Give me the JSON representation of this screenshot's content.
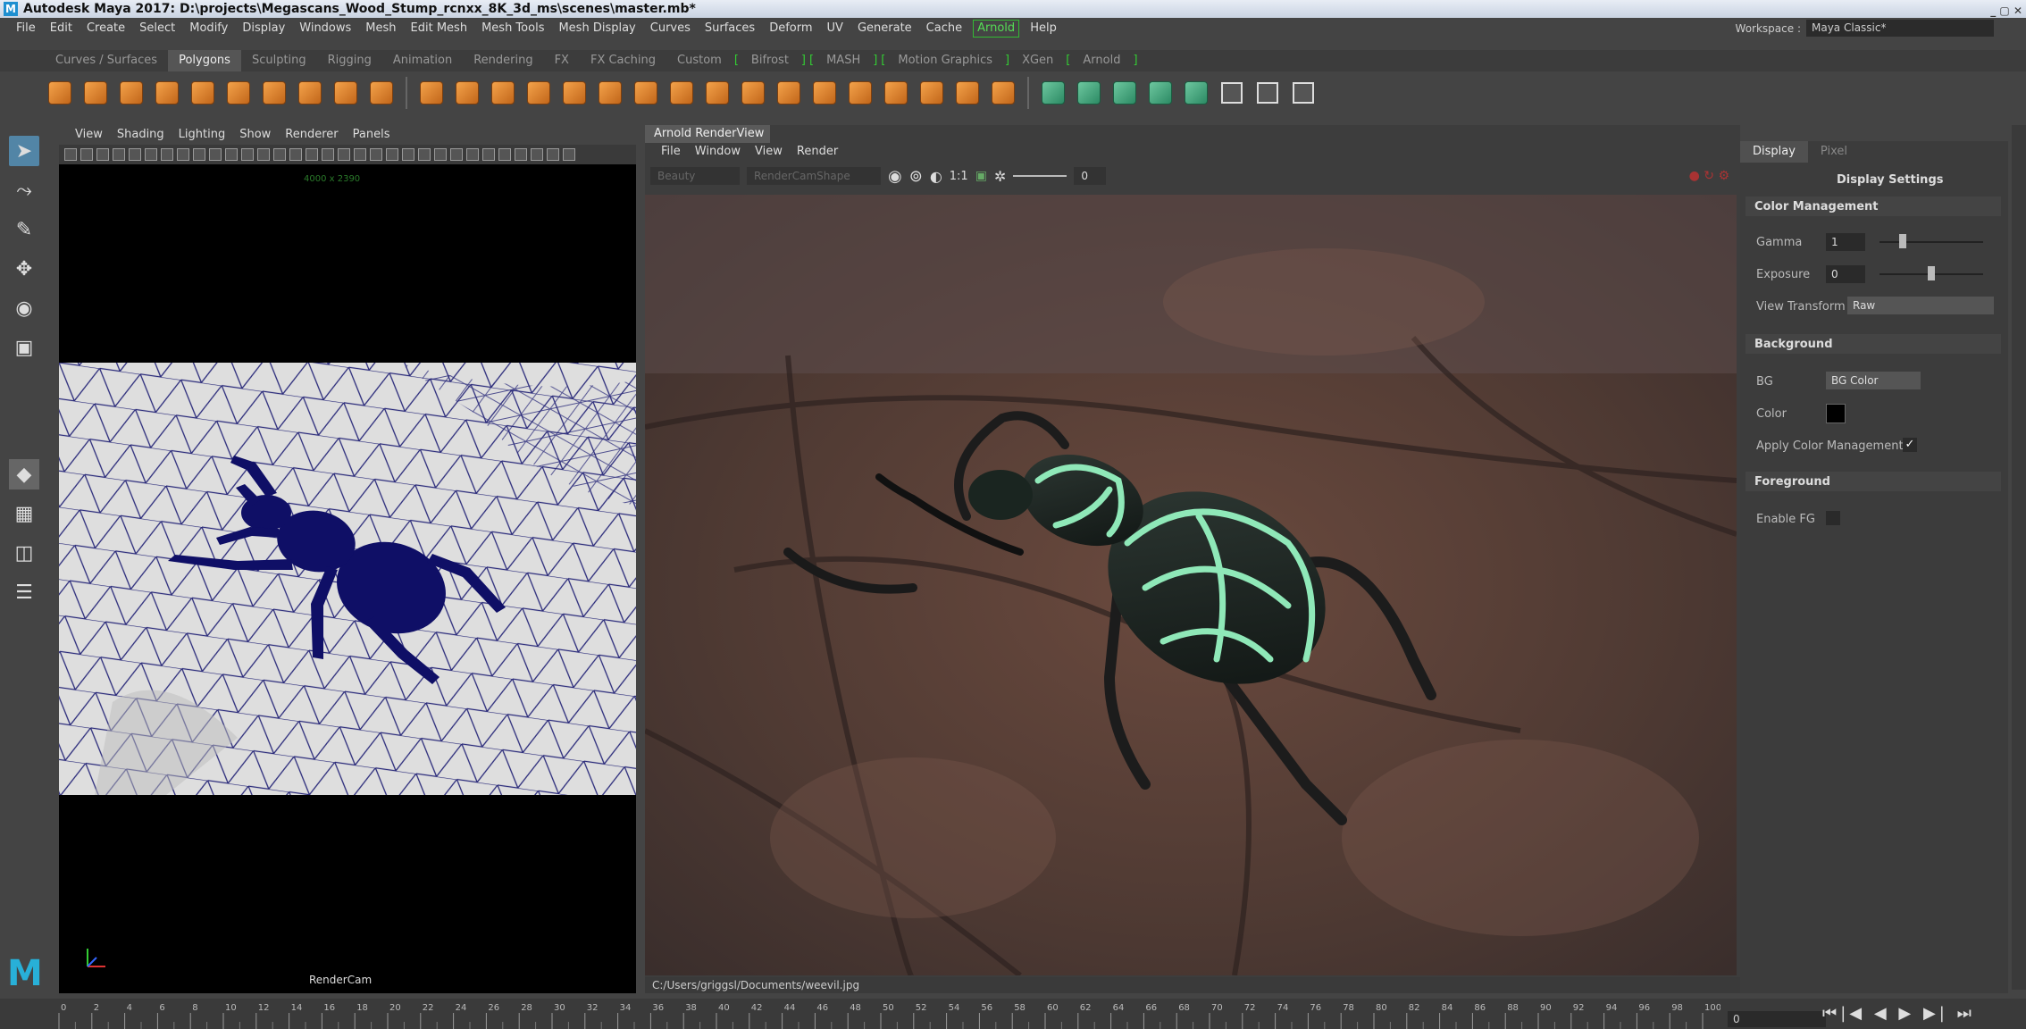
{
  "title": "Autodesk Maya 2017: D:\\projects\\Megascans_Wood_Stump_rcnxx_8K_3d_ms\\scenes\\master.mb*",
  "menus": [
    "File",
    "Edit",
    "Create",
    "Select",
    "Modify",
    "Display",
    "Windows",
    "Mesh",
    "Edit Mesh",
    "Mesh Tools",
    "Mesh Display",
    "Curves",
    "Surfaces",
    "Deform",
    "UV",
    "Generate",
    "Cache",
    "Arnold",
    "Help"
  ],
  "workspace": {
    "label": "Workspace :",
    "value": "Maya Classic*"
  },
  "shelf_tabs": [
    "Curves / Surfaces",
    "Polygons",
    "Sculpting",
    "Rigging",
    "Animation",
    "Rendering",
    "FX",
    "FX Caching",
    "Custom",
    "Bifrost",
    "MASH",
    "Motion Graphics",
    "XGen",
    "Arnold"
  ],
  "shelf_active": "Polygons",
  "viewport": {
    "menus": [
      "View",
      "Shading",
      "Lighting",
      "Show",
      "Renderer",
      "Panels"
    ],
    "resolution": "4000 x 2390",
    "camera": "RenderCam"
  },
  "renderview": {
    "title": "Arnold RenderView",
    "menus": [
      "File",
      "Window",
      "View",
      "Render"
    ],
    "aov": "Beauty",
    "camera": "RenderCamShape",
    "ratio": "1:1",
    "exposure_value": "0",
    "status_path": "C:/Users/griggsl/Documents/weevil.jpg"
  },
  "panel": {
    "tabs": [
      "Display",
      "Pixel"
    ],
    "heading": "Display Settings",
    "color_mgmt": {
      "title": "Color Management",
      "gamma_label": "Gamma",
      "gamma": "1",
      "exposure_label": "Exposure",
      "exposure": "0",
      "view_label": "View Transform",
      "view": "Raw"
    },
    "background": {
      "title": "Background",
      "bg_label": "BG",
      "bg": "BG Color",
      "color_label": "Color",
      "apply_label": "Apply Color Management"
    },
    "foreground": {
      "title": "Foreground",
      "enable_label": "Enable FG"
    }
  },
  "timeline": {
    "ticks": [
      "0",
      "2",
      "4",
      "6",
      "8",
      "10",
      "12",
      "14",
      "16",
      "18",
      "20",
      "22",
      "24",
      "26",
      "28",
      "30",
      "32",
      "34",
      "36",
      "38",
      "40",
      "42",
      "44",
      "46",
      "48",
      "50",
      "52",
      "54",
      "56",
      "58",
      "60",
      "62",
      "64",
      "66",
      "68",
      "70",
      "72",
      "74",
      "76",
      "78",
      "80",
      "82",
      "84",
      "86",
      "88",
      "90",
      "92",
      "94",
      "96",
      "98",
      "100"
    ],
    "current_frame": "0",
    "controls": "⏮|◀ ◀ ▶ ▶| ⏭"
  }
}
